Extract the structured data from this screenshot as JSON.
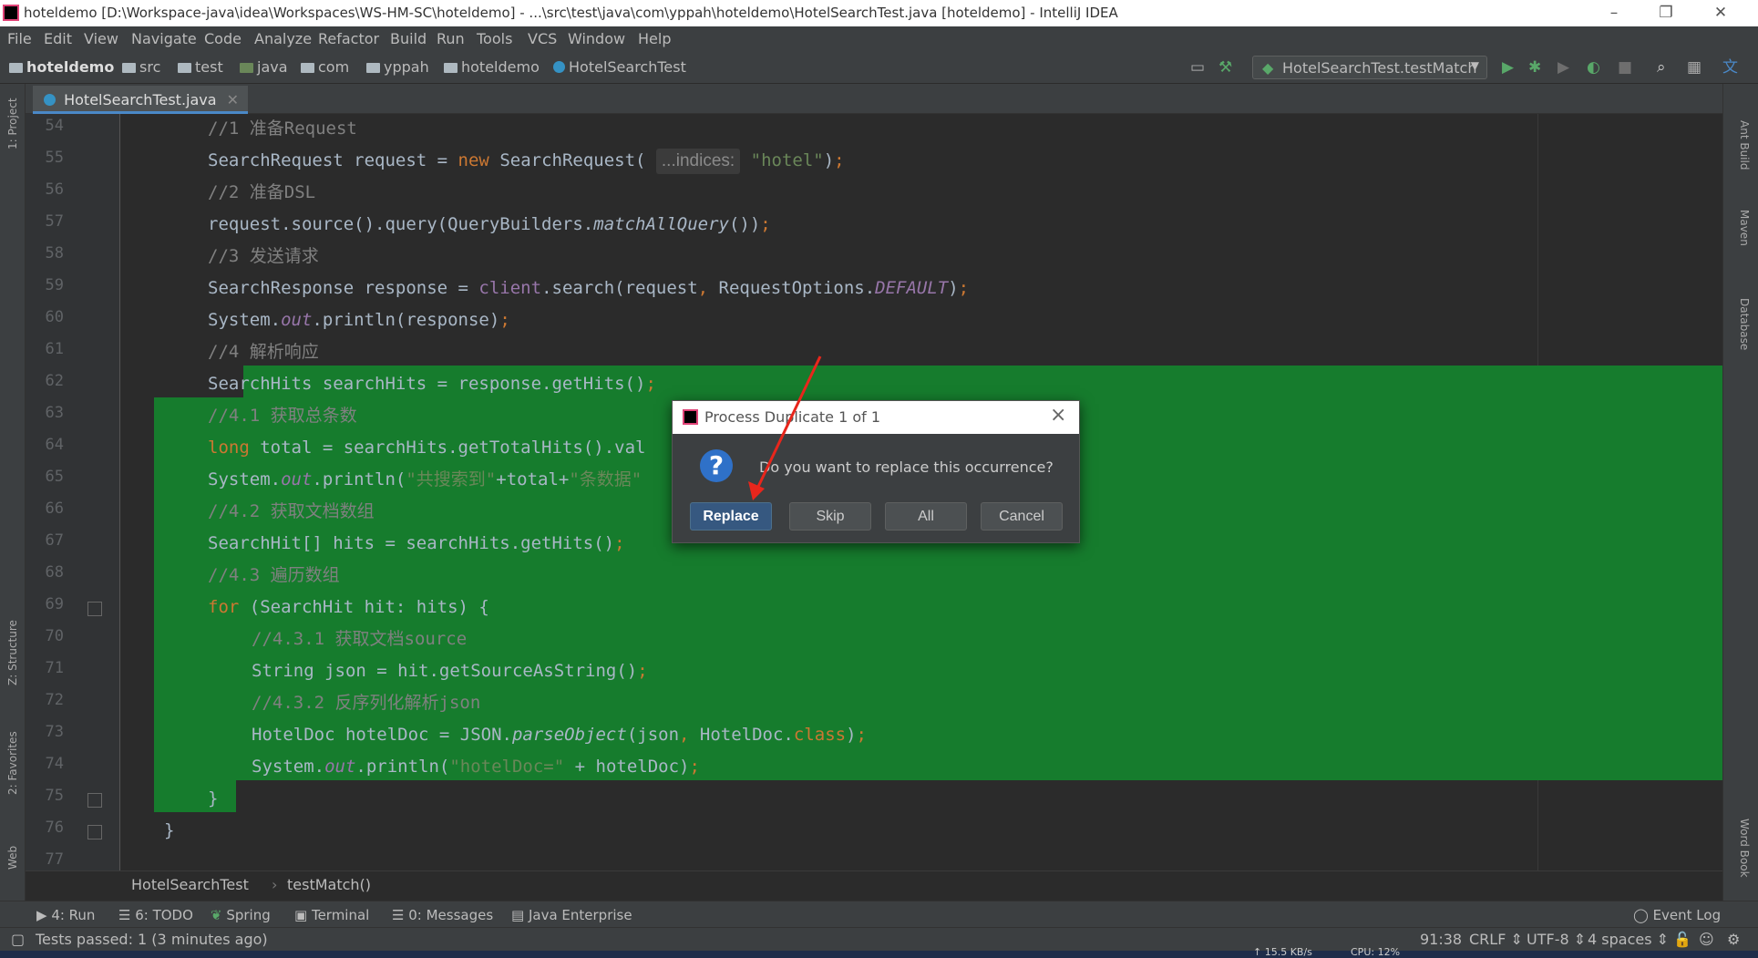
{
  "window": {
    "title": "hoteldemo [D:\\Workspace-java\\idea\\Workspaces\\WS-HM-SC\\hoteldemo] - ...\\src\\test\\java\\com\\yppah\\hoteldemo\\HotelSearchTest.java [hoteldemo] - IntelliJ IDEA"
  },
  "menu": [
    "File",
    "Edit",
    "View",
    "Navigate",
    "Code",
    "Analyze",
    "Refactor",
    "Build",
    "Run",
    "Tools",
    "VCS",
    "Window",
    "Help"
  ],
  "breadcrumb": [
    "hoteldemo",
    "src",
    "test",
    "java",
    "com",
    "yppah",
    "hoteldemo",
    "HotelSearchTest"
  ],
  "run_config": "HotelSearchTest.testMatch",
  "editor_tab": "HotelSearchTest.java",
  "left_tools": [
    "1: Project",
    "Z: Structure",
    "2: Favorites",
    "Web"
  ],
  "right_tools": [
    "Ant Build",
    "Maven",
    "Database",
    "Word Book"
  ],
  "code_lines": [
    {
      "n": "54",
      "html": "<span class=\"cm\">//1 准备Request</span>",
      "indent": 2
    },
    {
      "n": "55",
      "html": "SearchRequest request = <span class=\"kw\">new</span> SearchRequest( <span class=\"hint\">...indices:</span> <span class=\"st\">\"hotel\"</span>)<span class=\"kw\">;</span>",
      "indent": 2
    },
    {
      "n": "56",
      "html": "<span class=\"cm\">//2 准备DSL</span>",
      "indent": 2
    },
    {
      "n": "57",
      "html": "request.source().query(QueryBuilders.<span class=\"it\">matchAllQuery</span>())<span class=\"kw\">;</span>",
      "indent": 2
    },
    {
      "n": "58",
      "html": "<span class=\"cm\">//3 发送请求</span>",
      "indent": 2
    },
    {
      "n": "59",
      "html": "SearchResponse response = <span class=\"pv\">client</span>.search(request<span class=\"kw\">,</span> RequestOptions.<span class=\"fd\">DEFAULT</span>)<span class=\"kw\">;</span>",
      "indent": 2
    },
    {
      "n": "60",
      "html": "System.<span class=\"fd\">out</span>.println(response)<span class=\"kw\">;</span>",
      "indent": 2
    },
    {
      "n": "61",
      "html": "<span class=\"cm\">//4 解析响应</span>",
      "indent": 2
    },
    {
      "n": "62",
      "html": "SearchHits searchHits = response.getHits()<span class=\"kw\">;</span>",
      "indent": 2
    },
    {
      "n": "63",
      "html": "<span class=\"cm\">//4.1 获取总条数</span>",
      "indent": 2
    },
    {
      "n": "64",
      "html": "<span class=\"kw\">long</span> total = searchHits.getTotalHits().val",
      "indent": 2
    },
    {
      "n": "65",
      "html": "System.<span class=\"fd\">out</span>.println(<span class=\"st\">\"共搜索到\"</span>+total+<span class=\"st\">\"条数据\"</span>",
      "indent": 2
    },
    {
      "n": "66",
      "html": "<span class=\"cm\">//4.2 获取文档数组</span>",
      "indent": 2
    },
    {
      "n": "67",
      "html": "SearchHit[] hits = searchHits.getHits()<span class=\"kw\">;</span>",
      "indent": 2
    },
    {
      "n": "68",
      "html": "<span class=\"cm\">//4.3 遍历数组</span>",
      "indent": 2
    },
    {
      "n": "69",
      "html": "<span class=\"kw\">for</span> (SearchHit hit: hits) {",
      "indent": 2
    },
    {
      "n": "70",
      "html": "<span class=\"cm\">//4.3.1 获取文档source</span>",
      "indent": 3
    },
    {
      "n": "71",
      "html": "String json = hit.getSourceAsString()<span class=\"kw\">;</span>",
      "indent": 3
    },
    {
      "n": "72",
      "html": "<span class=\"cm\">//4.3.2 反序列化解析json</span>",
      "indent": 3
    },
    {
      "n": "73",
      "html": "HotelDoc hotelDoc = JSON.<span class=\"it\">parseObject</span>(json<span class=\"kw\">,</span> HotelDoc.<span class=\"kw\">class</span>)<span class=\"kw\">;</span>",
      "indent": 3
    },
    {
      "n": "74",
      "html": "System.<span class=\"fd\">out</span>.println(<span class=\"st\">\"hotelDoc=\"</span> + hotelDoc)<span class=\"kw\">;</span>",
      "indent": 3
    },
    {
      "n": "75",
      "html": "}",
      "indent": 2
    },
    {
      "n": "76",
      "html": "}",
      "indent": 1
    },
    {
      "n": "77",
      "html": "",
      "indent": 1
    }
  ],
  "code_crumbs": [
    "HotelSearchTest",
    "testMatch()"
  ],
  "tool_windows": [
    "4: Run",
    "6: TODO",
    "Spring",
    "Terminal",
    "0: Messages",
    "Java Enterprise"
  ],
  "event_log": "Event Log",
  "status": {
    "message": "Tests passed: 1 (3 minutes ago)",
    "position": "91:38",
    "line_sep": "CRLF",
    "encoding": "UTF-8",
    "indent": "4 spaces",
    "net": "15.5 KB/s",
    "cpu": "CPU: 12%"
  },
  "dialog": {
    "title": "Process Duplicate 1 of 1",
    "message": "Do you want to replace this occurrence?",
    "buttons": {
      "replace": "Replace",
      "skip": "Skip",
      "all": "All",
      "cancel": "Cancel"
    }
  },
  "colors": {
    "highlight": "#167c2d",
    "accent": "#365880",
    "arrow": "#e8261c"
  }
}
